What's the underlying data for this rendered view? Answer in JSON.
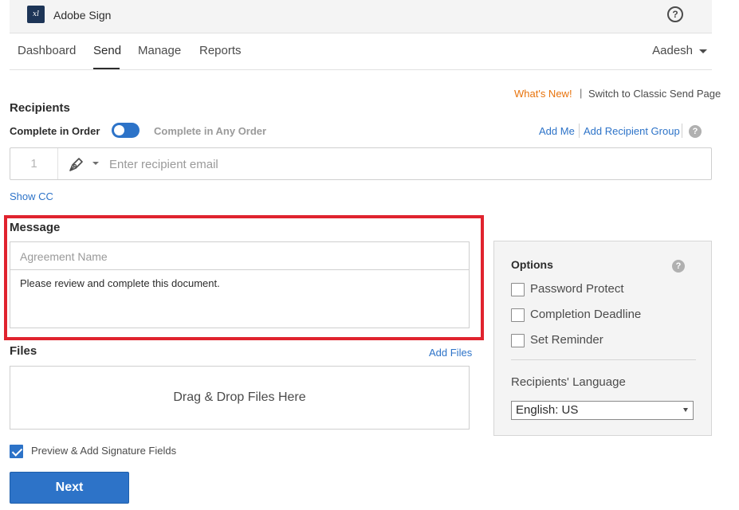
{
  "app": {
    "logo_text": "xl",
    "title": "Adobe Sign",
    "help_glyph": "?"
  },
  "nav": {
    "items": [
      {
        "label": "Dashboard"
      },
      {
        "label": "Send"
      },
      {
        "label": "Manage"
      },
      {
        "label": "Reports"
      }
    ],
    "active": "Send",
    "user": "Aadesh"
  },
  "top_links": {
    "whats_new": "What's New!",
    "separator": "|",
    "switch_classic": "Switch to Classic Send Page"
  },
  "recipients": {
    "heading": "Recipients",
    "complete_in_order": "Complete in Order",
    "complete_any_order": "Complete in Any Order",
    "order_toggle_on": true,
    "add_me": "Add Me",
    "add_recipient_group": "Add Recipient Group",
    "row_number": "1",
    "email_placeholder": "Enter recipient email",
    "show_cc": "Show CC"
  },
  "message": {
    "heading": "Message",
    "agreement_placeholder": "Agreement Name",
    "body": "Please review and complete this document."
  },
  "files": {
    "heading": "Files",
    "add_files": "Add Files",
    "dropzone_text": "Drag & Drop Files Here"
  },
  "preview": {
    "label": "Preview & Add Signature Fields",
    "checked": true
  },
  "next_label": "Next",
  "options": {
    "heading": "Options",
    "items": [
      {
        "label": "Password Protect",
        "checked": false
      },
      {
        "label": "Completion Deadline",
        "checked": false
      },
      {
        "label": "Set Reminder",
        "checked": false
      }
    ],
    "language_label": "Recipients' Language",
    "language_value": "English: US"
  },
  "colors": {
    "accent": "#2d73c8",
    "highlight": "#e0232e",
    "whats_new": "#e8730c"
  }
}
